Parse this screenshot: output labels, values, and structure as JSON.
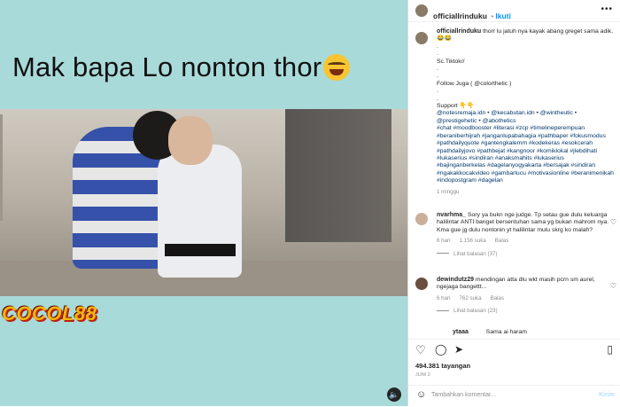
{
  "post": {
    "caption_overlay": "Mak bapa Lo nonton thor",
    "logo_text": "COCOL88",
    "author": "officiallrinduku",
    "follow_label": "Ikuti"
  },
  "caption": {
    "username": "officiallrinduku",
    "line1": "thorr lu jatuh nya kayak abang greget sama adik. 😂😂",
    "lines": [
      ".",
      ".",
      "Sc.Tiktok//",
      ".",
      ".",
      "Follow Juga ( @colorthetic )",
      ".",
      "."
    ],
    "support_label": "Support 👇👇",
    "support_handles": "@notesremaja.idn • @kecabutan.idn • @wintheutic • @prestigehetic • @abothetics",
    "hashtags": "#chat #moodbooster #literasi #zcp #timelineperempuan #beraniberhijrah #janganlupabahagia #pathbaper #fokusmodus #pathdailyquote #gantengkalemm #kodekeras #esokcerah #pathdailyjovo #pathbejat #kangnoor #komiklokal #jlebdihati #lukaserius #sindiran #anaksmahits #lukaserius #bajinganberkelas #dagelanyogyakarta #bersajak #sindiran #ngakakkocakvideo #gambarlucu #motivasionline #beranimenikah #indopostgram #dagelan",
    "time": "1 minggu"
  },
  "comments": [
    {
      "username": "nvarhma_",
      "text": "Sory ya bukn nge judge. Tp setau gue dulu keluarga halilintar ANTI banget bersentuhan sama yg bukan mahrom nya. Kma gue jg dulu nontonin yt halilintar mulu skrg ko malah?",
      "time": "6 hari",
      "likes": "1.156 suka",
      "reply_label": "Balas",
      "see_replies": "Lihat balasan (37)"
    },
    {
      "username": "dewindutz29",
      "text": "mendingan atta dlu wkt masih pcrn sm aurel, ngejaga bangettt...",
      "time": "6 hari",
      "likes": "762 suka",
      "reply_label": "Balas",
      "see_replies": "Lihat balasan (23)"
    }
  ],
  "cut_comment": {
    "username": "ytaaa",
    "text": "Sama ai haram"
  },
  "actions": {
    "likes_count": "494.381 tayangan",
    "date": "JUNI 2"
  },
  "comment_box": {
    "placeholder": "Tambahkan komentar...",
    "send_label": "Kirim"
  }
}
